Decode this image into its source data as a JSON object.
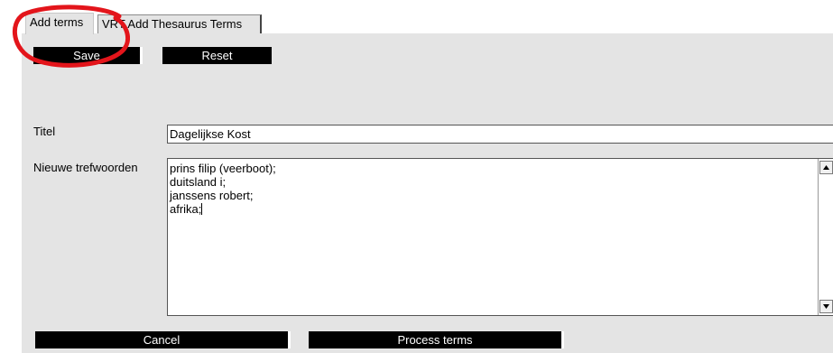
{
  "tabs": {
    "active_label": "Add terms",
    "inactive_label": "VRT Add Thesaurus Terms"
  },
  "toolbar": {
    "save_label": "Save",
    "reset_label": "Reset"
  },
  "form": {
    "titel_label": "Titel",
    "titel_value": "Dagelijkse Kost",
    "trefwoorden_label": "Nieuwe trefwoorden",
    "trefwoorden_lines": [
      "prins filip (veerboot);",
      "duitsland i;",
      "janssens robert;",
      "afrika;"
    ]
  },
  "footer": {
    "cancel_label": "Cancel",
    "process_label": "Process terms"
  },
  "annotation": {
    "ring_color": "#e3151b"
  }
}
